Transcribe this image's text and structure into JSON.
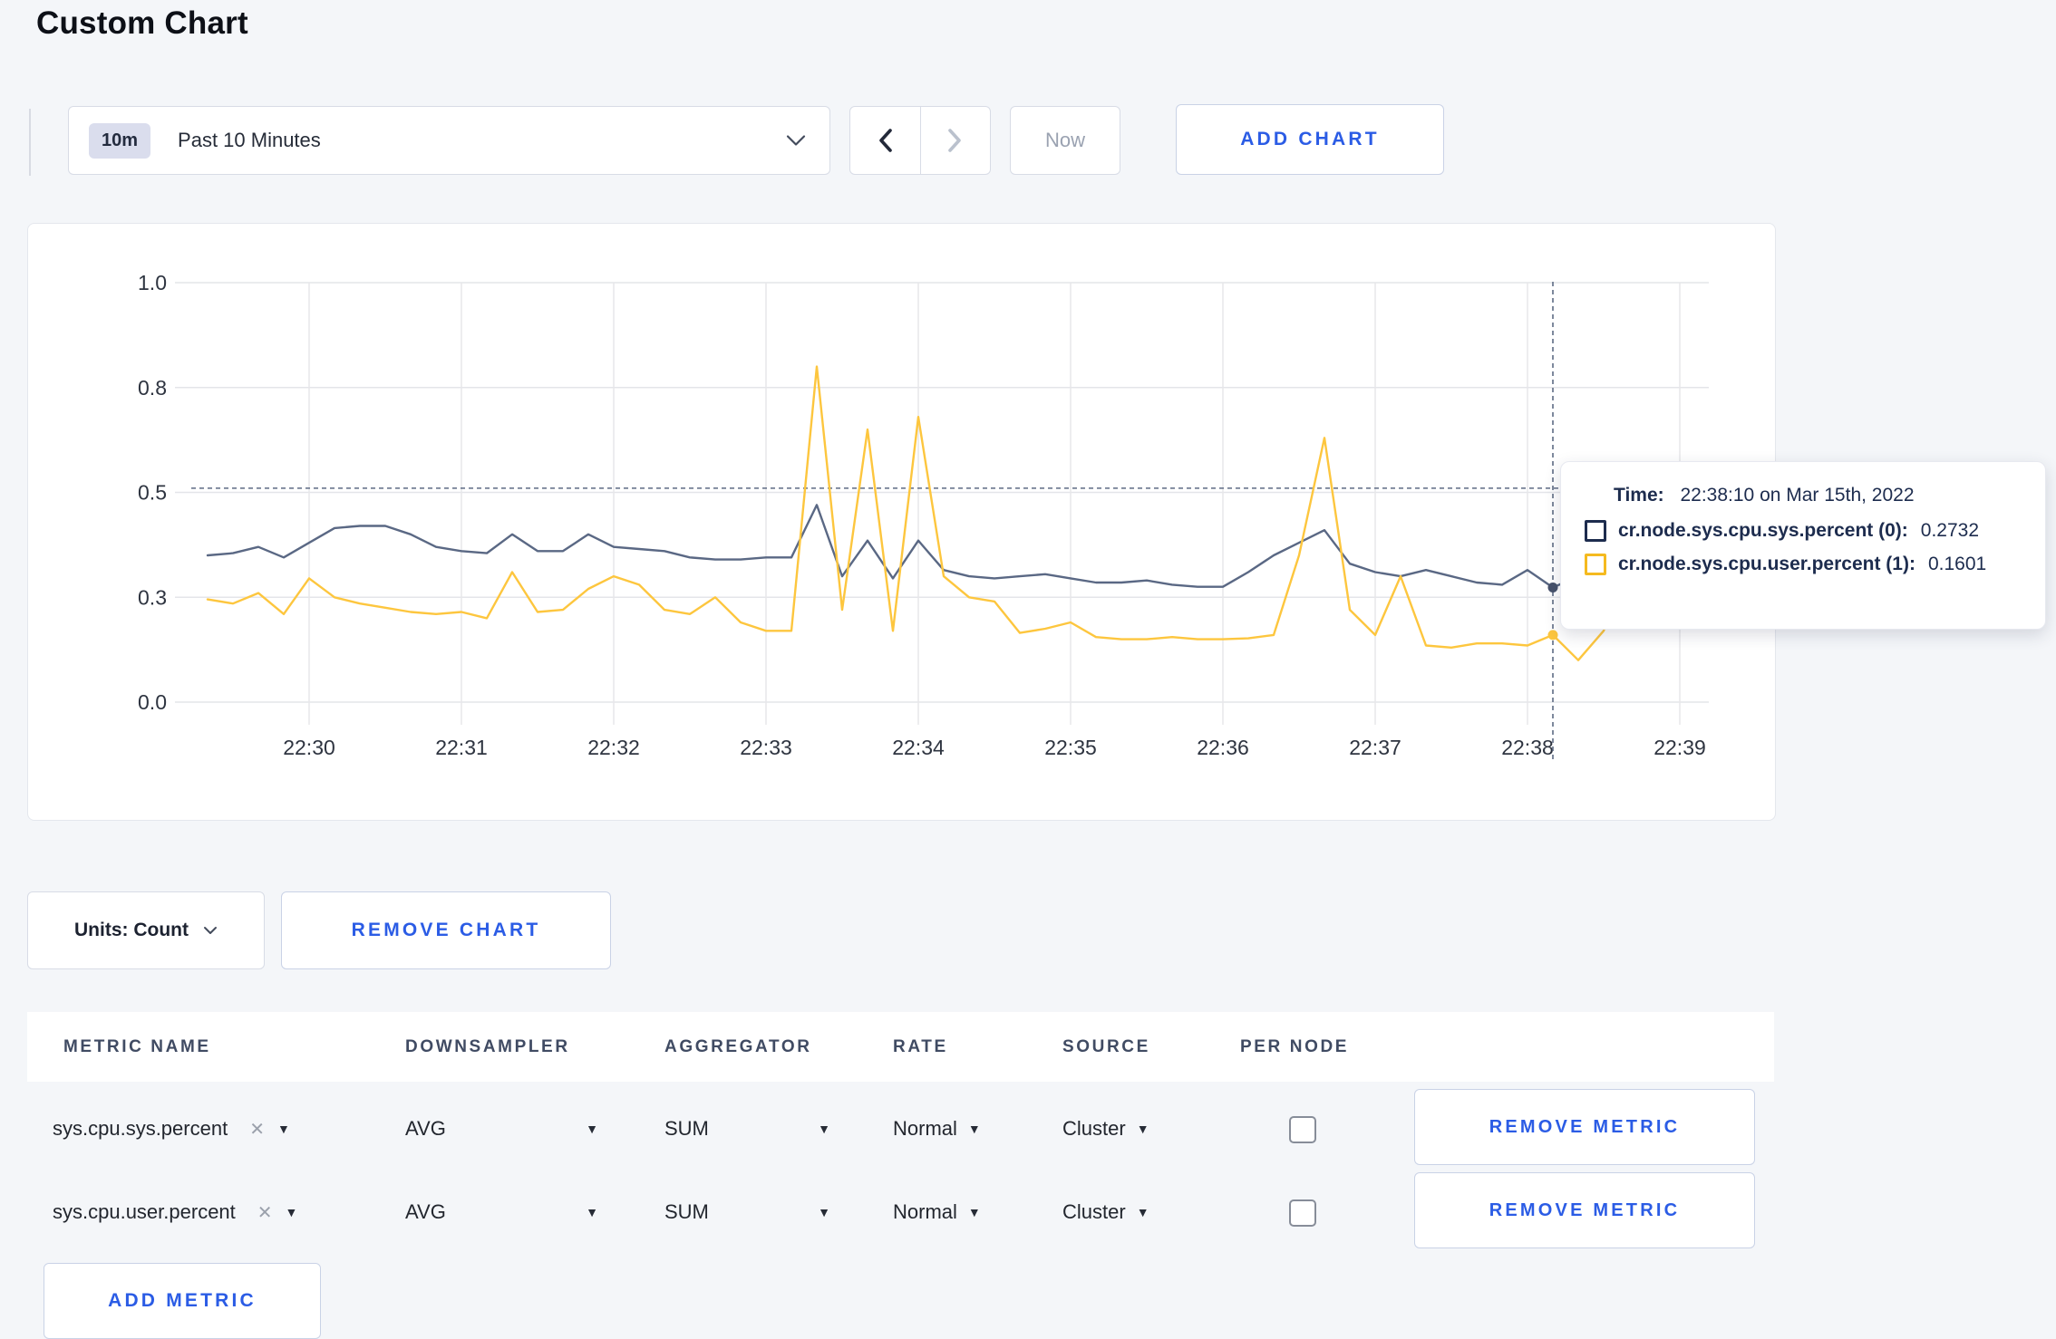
{
  "page": {
    "title": "Custom Chart"
  },
  "toolbar": {
    "time_badge": "10m",
    "time_range_label": "Past 10 Minutes",
    "now_label": "Now",
    "add_chart_label": "ADD CHART"
  },
  "chart_data": {
    "type": "line",
    "title": "",
    "xlabel": "",
    "ylabel": "",
    "ylim": [
      0,
      1
    ],
    "grid": true,
    "legend": "none",
    "x_tick_labels": [
      "22:30",
      "22:31",
      "22:32",
      "22:33",
      "22:34",
      "22:35",
      "22:36",
      "22:37",
      "22:38",
      "22:39"
    ],
    "y_ticks": [
      {
        "label": "0.0",
        "value": 0
      },
      {
        "label": "0.3",
        "value": 0.25
      },
      {
        "label": "0.5",
        "value": 0.5
      },
      {
        "label": "0.8",
        "value": 0.75
      },
      {
        "label": "1.0",
        "value": 1.0
      }
    ],
    "times": [
      "22:29:20",
      "22:29:30",
      "22:29:40",
      "22:29:50",
      "22:30:00",
      "22:30:10",
      "22:30:20",
      "22:30:30",
      "22:30:40",
      "22:30:50",
      "22:31:00",
      "22:31:10",
      "22:31:20",
      "22:31:30",
      "22:31:40",
      "22:31:50",
      "22:32:00",
      "22:32:10",
      "22:32:20",
      "22:32:30",
      "22:32:40",
      "22:32:50",
      "22:33:00",
      "22:33:10",
      "22:33:20",
      "22:33:30",
      "22:33:40",
      "22:33:50",
      "22:34:00",
      "22:34:10",
      "22:34:20",
      "22:34:30",
      "22:34:40",
      "22:34:50",
      "22:35:00",
      "22:35:10",
      "22:35:20",
      "22:35:30",
      "22:35:40",
      "22:35:50",
      "22:36:00",
      "22:36:10",
      "22:36:20",
      "22:36:30",
      "22:36:40",
      "22:36:50",
      "22:37:00",
      "22:37:10",
      "22:37:20",
      "22:37:30",
      "22:37:40",
      "22:37:50",
      "22:38:00",
      "22:38:10",
      "22:38:20",
      "22:38:30",
      "22:38:40",
      "22:38:50",
      "22:39:00",
      "22:39:10"
    ],
    "series": [
      {
        "name": "cr.node.sys.cpu.sys.percent",
        "color": "#5a6884",
        "values": [
          0.35,
          0.355,
          0.37,
          0.345,
          0.38,
          0.415,
          0.42,
          0.42,
          0.4,
          0.37,
          0.36,
          0.355,
          0.4,
          0.36,
          0.36,
          0.4,
          0.37,
          0.365,
          0.36,
          0.345,
          0.34,
          0.34,
          0.345,
          0.345,
          0.47,
          0.3,
          0.385,
          0.295,
          0.385,
          0.315,
          0.3,
          0.295,
          0.3,
          0.305,
          0.295,
          0.285,
          0.285,
          0.29,
          0.28,
          0.275,
          0.275,
          0.31,
          0.35,
          0.38,
          0.41,
          0.33,
          0.31,
          0.3,
          0.315,
          0.3,
          0.285,
          0.28,
          0.315,
          0.2732,
          0.3,
          0.295,
          0.3,
          0.3,
          0.295,
          0.3
        ]
      },
      {
        "name": "cr.node.sys.cpu.user.percent",
        "color": "#fdc63e",
        "values": [
          0.245,
          0.235,
          0.26,
          0.21,
          0.295,
          0.25,
          0.235,
          0.225,
          0.215,
          0.21,
          0.215,
          0.2,
          0.31,
          0.215,
          0.22,
          0.27,
          0.3,
          0.28,
          0.22,
          0.21,
          0.25,
          0.19,
          0.17,
          0.17,
          0.8,
          0.22,
          0.65,
          0.17,
          0.68,
          0.3,
          0.25,
          0.24,
          0.165,
          0.175,
          0.19,
          0.155,
          0.15,
          0.15,
          0.155,
          0.15,
          0.15,
          0.152,
          0.16,
          0.35,
          0.63,
          0.22,
          0.16,
          0.3,
          0.135,
          0.13,
          0.14,
          0.14,
          0.135,
          0.1601,
          0.1,
          0.17,
          0.31,
          0.25,
          0.21,
          0.26
        ]
      }
    ],
    "crosshair": {
      "time": "22:38:10",
      "hline_value": 0.51,
      "point_values": [
        0.2732,
        0.1601
      ]
    }
  },
  "tooltip": {
    "time_label": "Time:",
    "time_value": "22:38:10 on Mar 15th, 2022",
    "series": [
      {
        "label": "cr.node.sys.cpu.sys.percent (0):",
        "value": "0.2732",
        "color": "#1d2c4e"
      },
      {
        "label": "cr.node.sys.cpu.user.percent (1):",
        "value": "0.1601",
        "color": "#f5ba1f"
      }
    ]
  },
  "chart_controls": {
    "units_label": "Units: Count",
    "remove_chart_label": "REMOVE CHART"
  },
  "metrics_table": {
    "headers": [
      "METRIC NAME",
      "DOWNSAMPLER",
      "AGGREGATOR",
      "RATE",
      "SOURCE",
      "PER NODE"
    ],
    "rows": [
      {
        "metric_name": "sys.cpu.sys.percent",
        "downsampler": "AVG",
        "aggregator": "SUM",
        "rate": "Normal",
        "source": "Cluster",
        "per_node_checked": false,
        "remove_label": "REMOVE METRIC"
      },
      {
        "metric_name": "sys.cpu.user.percent",
        "downsampler": "AVG",
        "aggregator": "SUM",
        "rate": "Normal",
        "source": "Cluster",
        "per_node_checked": false,
        "remove_label": "REMOVE METRIC"
      }
    ],
    "add_metric_label": "ADD METRIC"
  }
}
